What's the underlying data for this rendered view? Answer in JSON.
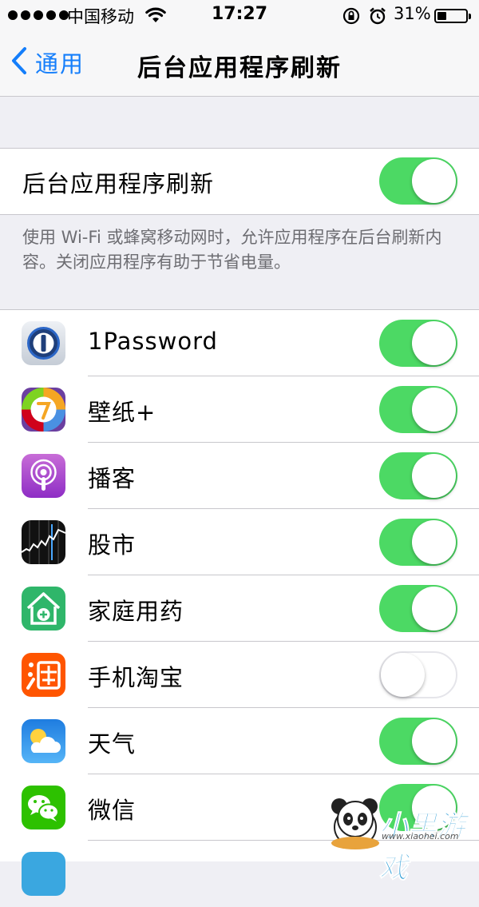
{
  "status_bar": {
    "carrier": "中国移动",
    "time": "17:27",
    "battery_percent": "31%",
    "battery_level": 0.31,
    "signal_dots": 5
  },
  "nav": {
    "back_label": "通用",
    "title": "后台应用程序刷新"
  },
  "master": {
    "label": "后台应用程序刷新",
    "enabled": true,
    "footer": "使用 Wi-Fi 或蜂窝移动网时，允许应用程序在后台刷新内容。关闭应用程序有助于节省电量。"
  },
  "apps": [
    {
      "name": "1Password",
      "enabled": true,
      "icon": "onepassword-icon"
    },
    {
      "name": "壁纸+",
      "enabled": true,
      "icon": "wallpaper-plus-icon"
    },
    {
      "name": "播客",
      "enabled": true,
      "icon": "podcasts-icon"
    },
    {
      "name": "股市",
      "enabled": true,
      "icon": "stocks-icon"
    },
    {
      "name": "家庭用药",
      "enabled": true,
      "icon": "family-medicine-icon"
    },
    {
      "name": "手机淘宝",
      "enabled": false,
      "icon": "taobao-icon"
    },
    {
      "name": "天气",
      "enabled": true,
      "icon": "weather-icon"
    },
    {
      "name": "微信",
      "enabled": true,
      "icon": "wechat-icon"
    }
  ],
  "watermark": {
    "text": "小黑游戏",
    "url_text": "www.xiaohei.com"
  }
}
